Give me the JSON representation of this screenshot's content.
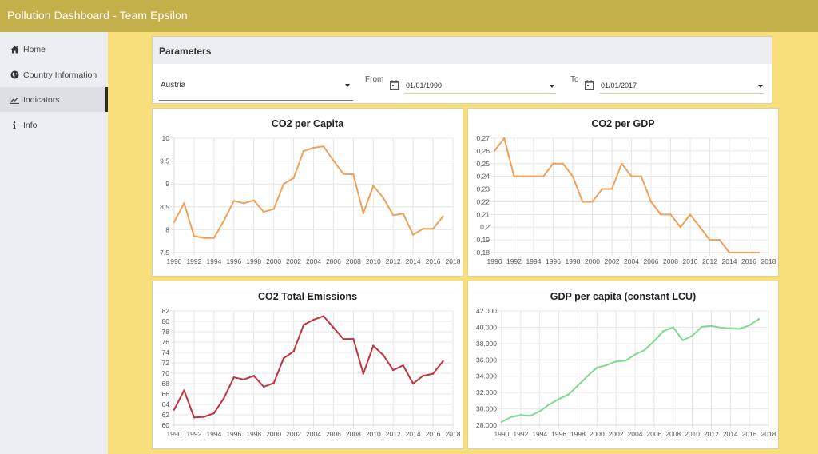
{
  "app": {
    "title": "Pollution Dashboard - Team Epsilon"
  },
  "sidebar": {
    "items": [
      {
        "label": "Home",
        "icon": "home-icon",
        "active": false
      },
      {
        "label": "Country Information",
        "icon": "globe-icon",
        "active": false
      },
      {
        "label": "Indicators",
        "icon": "line-chart-icon",
        "active": true
      },
      {
        "label": "Info",
        "icon": "info-icon",
        "active": false
      }
    ]
  },
  "parameters": {
    "title": "Parameters",
    "country": {
      "value": "Austria"
    },
    "from": {
      "label": "From",
      "value": "01/01/1990",
      "icon": "calendar-icon"
    },
    "to": {
      "label": "To",
      "value": "01/01/2017",
      "icon": "calendar-icon"
    }
  },
  "colors": {
    "header": "#c4b04a",
    "background": "#f9df7b",
    "sidebar": "#eceff1",
    "orange_series": "#f0a057",
    "red_series": "#c0333e",
    "green_series": "#7fd98f"
  },
  "chart_data": [
    {
      "id": "co2_per_capita",
      "type": "line",
      "title": "CO2 per Capita",
      "xlabel": "",
      "ylabel": "",
      "x": [
        1990,
        1991,
        1992,
        1993,
        1994,
        1995,
        1996,
        1997,
        1998,
        1999,
        2000,
        2001,
        2002,
        2003,
        2004,
        2005,
        2006,
        2007,
        2008,
        2009,
        2010,
        2011,
        2012,
        2013,
        2014,
        2015,
        2016,
        2017
      ],
      "series": [
        {
          "name": "CO2 per Capita",
          "color": "#f0a057",
          "values": [
            8.17,
            8.58,
            7.86,
            7.82,
            7.82,
            8.2,
            8.63,
            8.58,
            8.64,
            8.39,
            8.45,
            9.0,
            9.13,
            9.72,
            9.79,
            9.82,
            9.51,
            9.22,
            9.21,
            8.36,
            8.96,
            8.7,
            8.32,
            8.35,
            7.89,
            8.02,
            8.02,
            8.29
          ]
        }
      ],
      "xlim": [
        1990,
        2018
      ],
      "xticks": [
        "1990",
        "1992",
        "1994",
        "1996",
        "1998",
        "2000",
        "2002",
        "2004",
        "2006",
        "2008",
        "2010",
        "2012",
        "2014",
        "2016",
        "2018"
      ],
      "ylim": [
        7.5,
        10
      ],
      "yticks": [
        {
          "v": 7.5,
          "label": "7,5"
        },
        {
          "v": 8,
          "label": "8"
        },
        {
          "v": 8.5,
          "label": "8,5"
        },
        {
          "v": 9,
          "label": "9"
        },
        {
          "v": 9.5,
          "label": "9,5"
        },
        {
          "v": 10,
          "label": "10"
        }
      ],
      "grid": true,
      "legend": "none"
    },
    {
      "id": "co2_per_gdp",
      "type": "line",
      "title": "CO2 per GDP",
      "xlabel": "",
      "ylabel": "",
      "x": [
        1990,
        1991,
        1992,
        1993,
        1994,
        1995,
        1996,
        1997,
        1998,
        1999,
        2000,
        2001,
        2002,
        2003,
        2004,
        2005,
        2006,
        2007,
        2008,
        2009,
        2010,
        2011,
        2012,
        2013,
        2014,
        2015,
        2016,
        2017
      ],
      "series": [
        {
          "name": "CO2 per GDP",
          "color": "#f0a057",
          "values": [
            0.26,
            0.27,
            0.24,
            0.24,
            0.24,
            0.24,
            0.25,
            0.25,
            0.24,
            0.22,
            0.22,
            0.23,
            0.23,
            0.25,
            0.24,
            0.24,
            0.22,
            0.21,
            0.21,
            0.2,
            0.21,
            0.2,
            0.19,
            0.19,
            0.18,
            0.18,
            0.18,
            0.18
          ]
        }
      ],
      "xlim": [
        1990,
        2018
      ],
      "xticks": [
        "1990",
        "1992",
        "1994",
        "1996",
        "1998",
        "2000",
        "2002",
        "2004",
        "2006",
        "2008",
        "2010",
        "2012",
        "2014",
        "2016",
        "2018"
      ],
      "ylim": [
        0.18,
        0.27
      ],
      "yticks": [
        {
          "v": 0.18,
          "label": "0,18"
        },
        {
          "v": 0.19,
          "label": "0,19"
        },
        {
          "v": 0.2,
          "label": "0,2"
        },
        {
          "v": 0.21,
          "label": "0,21"
        },
        {
          "v": 0.22,
          "label": "0,22"
        },
        {
          "v": 0.23,
          "label": "0,23"
        },
        {
          "v": 0.24,
          "label": "0,24"
        },
        {
          "v": 0.25,
          "label": "0,25"
        },
        {
          "v": 0.26,
          "label": "0,26"
        },
        {
          "v": 0.27,
          "label": "0,27"
        }
      ],
      "grid": true,
      "legend": "none"
    },
    {
      "id": "co2_total",
      "type": "line",
      "title": "CO2 Total Emissions",
      "xlabel": "",
      "ylabel": "",
      "x": [
        1990,
        1991,
        1992,
        1993,
        1994,
        1995,
        1996,
        1997,
        1998,
        1999,
        2000,
        2001,
        2002,
        2003,
        2004,
        2005,
        2006,
        2007,
        2008,
        2009,
        2010,
        2011,
        2012,
        2013,
        2014,
        2015,
        2016,
        2017
      ],
      "series": [
        {
          "name": "CO2 Total Emissions",
          "color": "#c0333e",
          "values": [
            63.0,
            66.7,
            61.5,
            61.6,
            62.3,
            65.2,
            69.2,
            68.8,
            69.5,
            67.4,
            68.1,
            72.9,
            74.2,
            79.3,
            80.3,
            81.0,
            78.8,
            76.6,
            76.6,
            69.9,
            75.3,
            73.5,
            70.6,
            71.5,
            68.0,
            69.5,
            69.9,
            72.3
          ]
        }
      ],
      "xlim": [
        1990,
        2018
      ],
      "xticks": [
        "1990",
        "1992",
        "1994",
        "1996",
        "1998",
        "2000",
        "2002",
        "2004",
        "2006",
        "2008",
        "2010",
        "2012",
        "2014",
        "2016",
        "2018"
      ],
      "ylim": [
        60,
        82
      ],
      "yticks": [
        {
          "v": 60,
          "label": "60"
        },
        {
          "v": 62,
          "label": "62"
        },
        {
          "v": 64,
          "label": "64"
        },
        {
          "v": 66,
          "label": "66"
        },
        {
          "v": 68,
          "label": "68"
        },
        {
          "v": 70,
          "label": "70"
        },
        {
          "v": 72,
          "label": "72"
        },
        {
          "v": 74,
          "label": "74"
        },
        {
          "v": 76,
          "label": "76"
        },
        {
          "v": 78,
          "label": "78"
        },
        {
          "v": 80,
          "label": "80"
        },
        {
          "v": 82,
          "label": "82"
        }
      ],
      "grid": true,
      "legend": "none"
    },
    {
      "id": "gdp_per_capita",
      "type": "line",
      "title": "GDP per capita (constant LCU)",
      "xlabel": "",
      "ylabel": "",
      "x": [
        1990,
        1991,
        1992,
        1993,
        1994,
        1995,
        1996,
        1997,
        1998,
        1999,
        2000,
        2001,
        2002,
        2003,
        2004,
        2005,
        2006,
        2007,
        2008,
        2009,
        2010,
        2011,
        2012,
        2013,
        2014,
        2015,
        2016,
        2017
      ],
      "series": [
        {
          "name": "GDP per capita",
          "color": "#7fd98f",
          "values": [
            28400,
            29000,
            29250,
            29150,
            29700,
            30550,
            31200,
            31750,
            32850,
            34000,
            35050,
            35350,
            35800,
            35900,
            36650,
            37200,
            38300,
            39550,
            40000,
            38400,
            38950,
            40050,
            40150,
            39950,
            39850,
            39800,
            40250,
            41000
          ]
        }
      ],
      "xlim": [
        1990,
        2018
      ],
      "xticks": [
        "1990",
        "1992",
        "1994",
        "1996",
        "1998",
        "2000",
        "2002",
        "2004",
        "2006",
        "2008",
        "2010",
        "2012",
        "2014",
        "2016",
        "2018"
      ],
      "ylim": [
        28000,
        42000
      ],
      "yticks": [
        {
          "v": 28000,
          "label": "28.000"
        },
        {
          "v": 30000,
          "label": "30.000"
        },
        {
          "v": 32000,
          "label": "32.000"
        },
        {
          "v": 34000,
          "label": "34.000"
        },
        {
          "v": 36000,
          "label": "36.000"
        },
        {
          "v": 38000,
          "label": "38.000"
        },
        {
          "v": 40000,
          "label": "40.000"
        },
        {
          "v": 42000,
          "label": "42.000"
        }
      ],
      "grid": true,
      "legend": "none"
    }
  ]
}
